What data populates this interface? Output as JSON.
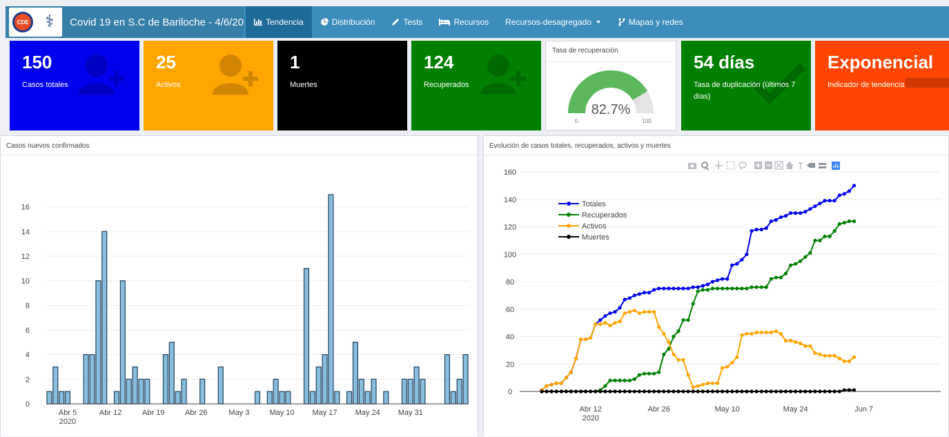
{
  "header": {
    "title": "Covid 19 en S.C de Bariloche - 4/6/20",
    "logo_text": "CDE",
    "nav": [
      {
        "label": "Tendencia",
        "icon": "bar-chart-icon",
        "active": true
      },
      {
        "label": "Distribución",
        "icon": "pie-chart-icon",
        "active": false
      },
      {
        "label": "Tests",
        "icon": "pencil-icon",
        "active": false
      },
      {
        "label": "Recursos",
        "icon": "bed-icon",
        "active": false
      },
      {
        "label": "Recursos-desagregado",
        "icon": "caret-down-icon",
        "active": false
      },
      {
        "label": "Mapas y redes",
        "icon": "network-icon",
        "active": false
      }
    ]
  },
  "colors": {
    "totales": "#0000ee",
    "activos": "#ffa500",
    "muertes": "#000000",
    "recuperados": "#008000",
    "duplicacion": "#008000",
    "tendencia": "#ff4500",
    "bars": "#89bede"
  },
  "boxes": {
    "totales": {
      "value": "150",
      "label": "Casos totales"
    },
    "activos": {
      "value": "25",
      "label": "Activos"
    },
    "muertes": {
      "value": "1",
      "label": "Muertes"
    },
    "recuperados": {
      "value": "124",
      "label": "Recuperados"
    },
    "duplicacion": {
      "value": "54 días",
      "label": "Tasa de duplicación (últimos 7 días)"
    },
    "tendencia": {
      "value": "Exponencial",
      "label": "Indicador de tendencia"
    }
  },
  "gauge": {
    "title": "Tasa de recuperación",
    "value": 82.7,
    "value_text": "82.7%",
    "min": "0",
    "max": "100"
  },
  "panels": {
    "left_title": "Casos nuevos confirmados",
    "right_title": "Evolución de casos totales, recuperados, activos y muertes"
  },
  "chart_data": [
    {
      "type": "bar",
      "title": "Casos nuevos confirmados",
      "x_start": "2020-04-02",
      "values": [
        1,
        3,
        1,
        1,
        0,
        0,
        4,
        4,
        10,
        14,
        0,
        1,
        10,
        2,
        3,
        2,
        2,
        0,
        0,
        4,
        5,
        1,
        2,
        0,
        0,
        2,
        0,
        0,
        3,
        0,
        0,
        0,
        0,
        0,
        1,
        0,
        1,
        2,
        1,
        1,
        0,
        0,
        11,
        1,
        3,
        4,
        17,
        1,
        0,
        1,
        5,
        2,
        1,
        2,
        0,
        1,
        0,
        0,
        2,
        2,
        3,
        2,
        0,
        0,
        0,
        4,
        1,
        2,
        4
      ],
      "x_tick_labels": [
        "Abr 5\n2020",
        "Abr 12",
        "Abr 19",
        "Abr 26",
        "May 3",
        "May 10",
        "May 17",
        "May 24",
        "May 31"
      ],
      "ylim": [
        0,
        17.5
      ],
      "y_ticks": [
        0,
        2,
        4,
        6,
        8,
        10,
        12,
        14,
        16
      ],
      "grid": true
    },
    {
      "type": "line",
      "title": "Evolución de casos totales, recuperados, activos y muertes",
      "x_start": "2020-04-02",
      "x_tick_labels": [
        "Abr 12\n2020",
        "Abr 26",
        "May 10",
        "May 24",
        "Jun 7"
      ],
      "ylim": [
        0,
        160
      ],
      "y_ticks": [
        0,
        20,
        40,
        60,
        80,
        100,
        120,
        140,
        160
      ],
      "legend_position": "top-left",
      "grid": true,
      "series": [
        {
          "name": "Totales",
          "color": "#0000ee",
          "values": [
            1,
            4,
            5,
            6,
            6,
            10,
            14,
            24,
            38,
            38,
            39,
            49,
            52,
            55,
            57,
            58,
            61,
            67,
            68,
            70,
            71,
            72,
            72,
            74,
            75,
            75,
            75,
            75,
            75,
            75,
            75,
            76,
            76,
            77,
            78,
            80,
            81,
            82,
            82,
            92,
            93,
            96,
            100,
            117,
            118,
            118,
            119,
            124,
            125,
            127,
            128,
            130,
            130,
            130,
            131,
            133,
            135,
            137,
            139,
            139,
            139,
            143,
            144,
            146,
            150
          ]
        },
        {
          "name": "Recuperados",
          "color": "#008000",
          "values": [
            0,
            0,
            0,
            0,
            0,
            0,
            0,
            0,
            0,
            0,
            0,
            0,
            1,
            4,
            8,
            8,
            8,
            8,
            8,
            9,
            12,
            13,
            13,
            13,
            14,
            27,
            31,
            40,
            44,
            52,
            52,
            64,
            73,
            74,
            74,
            75,
            75,
            75,
            75,
            75,
            75,
            75,
            75,
            76,
            76,
            76,
            76,
            82,
            83,
            83,
            86,
            92,
            93,
            95,
            98,
            101,
            110,
            110,
            113,
            113,
            117,
            122,
            123,
            124,
            124
          ]
        },
        {
          "name": "Activos",
          "color": "#ffa500",
          "values": [
            1,
            4,
            5,
            6,
            6,
            10,
            14,
            24,
            38,
            38,
            39,
            49,
            49,
            50,
            48,
            50,
            51,
            57,
            58,
            59,
            57,
            58,
            58,
            58,
            47,
            42,
            36,
            27,
            23,
            23,
            12,
            3,
            4,
            5,
            6,
            6,
            6,
            17,
            18,
            21,
            25,
            41,
            42,
            42,
            43,
            43,
            43,
            43,
            44,
            42,
            37,
            37,
            36,
            35,
            33,
            33,
            28,
            27,
            26,
            26,
            26,
            24,
            22,
            22,
            25
          ]
        },
        {
          "name": "Muertes",
          "color": "#000000",
          "values": [
            0,
            0,
            0,
            0,
            0,
            0,
            0,
            0,
            0,
            0,
            0,
            0,
            0,
            0,
            0,
            0,
            0,
            0,
            0,
            0,
            0,
            0,
            0,
            0,
            0,
            0,
            0,
            0,
            0,
            0,
            0,
            0,
            0,
            0,
            0,
            0,
            0,
            0,
            0,
            0,
            0,
            0,
            0,
            0,
            0,
            0,
            0,
            0,
            0,
            0,
            0,
            0,
            0,
            0,
            0,
            0,
            0,
            0,
            0,
            0,
            0,
            0,
            1,
            1,
            1
          ]
        }
      ]
    }
  ]
}
